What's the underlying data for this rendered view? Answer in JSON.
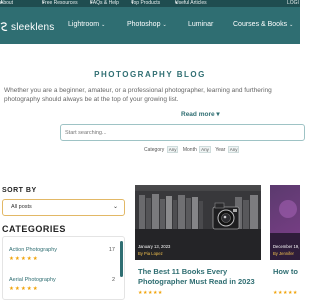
{
  "topbar": {
    "items": [
      {
        "label": "About",
        "chev": "▾"
      },
      {
        "label": "Free Resources",
        "chev": "▾"
      },
      {
        "label": "FAQs & Help",
        "chev": "▾"
      },
      {
        "label": "Top Products",
        "chev": "▾"
      },
      {
        "label": "Useful Articles",
        "chev": "▾"
      },
      {
        "label": "LOGI",
        "chev": ""
      }
    ]
  },
  "nav": {
    "logo_text": "sleeklens",
    "items": [
      {
        "label": "Lightroom",
        "chev": "⌄"
      },
      {
        "label": "Photoshop",
        "chev": "⌄"
      },
      {
        "label": "Luminar",
        "chev": ""
      },
      {
        "label": "Courses & Books",
        "chev": "⌄"
      }
    ]
  },
  "hero": {
    "title": "PHOTOGRAPHY BLOG",
    "intro_line1": "Whether you are a beginner, amateur, or a professional photographer, learning and furthering",
    "intro_line2": "photography should always be at the top of your growing list.",
    "read_more": "Read more",
    "read_more_chev": "▾"
  },
  "search": {
    "placeholder": "Start searching..."
  },
  "filters": {
    "category_label": "Category",
    "category_value": "Any",
    "month_label": "Month",
    "month_value": "Any",
    "year_label": "Year",
    "year_value": "Any"
  },
  "sort": {
    "label": "SORT BY",
    "value": "All posts",
    "chev": "⌄"
  },
  "categories": {
    "label": "CATEGORIES",
    "items": [
      {
        "name": "Action Photography",
        "count": "17",
        "stars": "★★★★★"
      },
      {
        "name": "Aerial Photography",
        "count": "2",
        "stars": "★★★★★"
      }
    ]
  },
  "posts": [
    {
      "date": "January 13, 2023",
      "author": "By Pia Lopez",
      "title": "The Best 11 Books Every Photographer Must Read in 2023",
      "stars": "★★★★★"
    },
    {
      "date": "December 19,",
      "author": "By Jennifer",
      "title": "How to Do",
      "stars": "★★★★★"
    }
  ],
  "colors": {
    "topbar_bg": "#1f4d50",
    "navbar_bg": "#2f6e72",
    "accent": "#2f6e72",
    "star": "#f0a30a",
    "sort_border": "#e2b866"
  }
}
